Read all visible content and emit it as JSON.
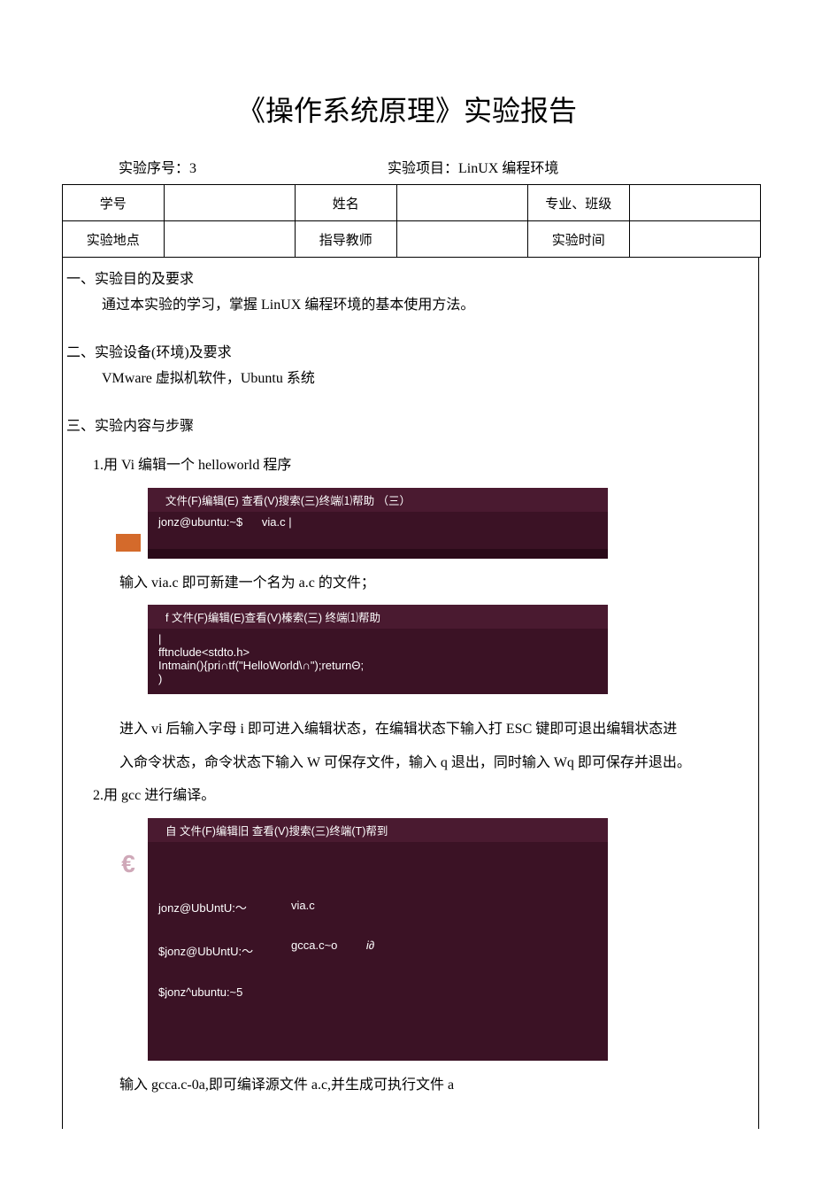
{
  "title": "《操作系统原理》实验报告",
  "meta": {
    "seq_label": "实验序号：",
    "seq_value": "3",
    "proj_label": "实验项目：",
    "proj_value": "LinUX 编程环境"
  },
  "info": {
    "r1c1": "学号",
    "r1c3": "姓名",
    "r1c5": "专业、班级",
    "r2c1": "实验地点",
    "r2c3": "指导教师",
    "r2c5": "实验时间"
  },
  "sec1_head": "一、实验目的及要求",
  "sec1_p1": "通过本实验的学习，掌握 LinUX 编程环境的基本使用方法。",
  "sec2_head": "二、实验设备(环境)及要求",
  "sec2_p1": "VMware 虚拟机软件，Ubuntu 系统",
  "sec3_head": "三、实验内容与步骤",
  "step1": "1.用 Vi 编辑一个 helloworld 程序",
  "term1": {
    "menu": "文件(F)编辑(E)      查看(V)搜索(三)终端⑴帮助 （三）",
    "line1_prompt": "jonz@ubuntu:~$",
    "line1_cmd": "via.c"
  },
  "p_after_t1": "输入 via.c 即可新建一个名为 a.c 的文件；",
  "term2": {
    "menu": "f 文件(F)编辑(E)查看(V)榛索(三)            终端⑴帮助",
    "line1": "|",
    "line2": "fftnclude<stdto.h>",
    "line3": "Intmain(){pri∩tf(\"HelloWorld\\∩\");returnΘ;",
    "line4": ")"
  },
  "p_after_t2a": "进入 vi 后输入字母 i 即可进入编辑状态，在编辑状态下输入打 ESC 键即可退出编辑状态进",
  "p_after_t2b": "入命令状态，命令状态下输入 W 可保存文件，输入 q 退出，同时输入 Wq 即可保存并退出。",
  "step2": "2.用 gcc 进行编译。",
  "term3": {
    "menu": "自 文件(F)编辑旧       查看(V)搜索(三)终端(T)帮到",
    "col1_l1": "jonz@UbUntU:～",
    "col1_l2": "$jonz@UbUntU:～",
    "col1_l3": "$jonz^ubuntu:~5",
    "col2_l1": "via.c",
    "col2_l2": "gcca.c~o",
    "col2_r": "i∂"
  },
  "p_after_t3": "输入 gcca.c-0a,即可编译源文件 a.c,并生成可执行文件 a"
}
